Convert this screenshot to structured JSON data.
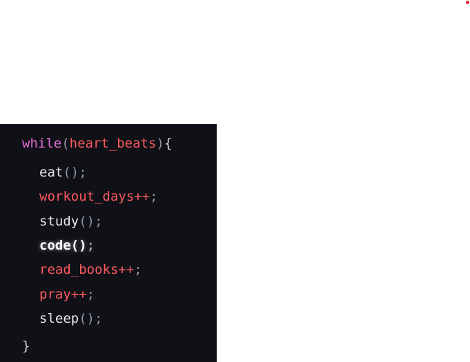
{
  "accent": {
    "dot_color": "#e8232a",
    "background": "#0f1117",
    "keyword_color": "#e26bd8",
    "identifier_red": "#ff5a5f"
  },
  "code": {
    "line0": {
      "keyword": "while",
      "open_paren": "(",
      "condition": "heart_beats",
      "close_paren": ")",
      "open_brace": "{"
    },
    "line1": {
      "fn": "eat",
      "call": "()",
      "semi": ";"
    },
    "line2": {
      "var": "workout_days++",
      "semi": ";"
    },
    "line3": {
      "fn": "study",
      "call": "()",
      "semi": ";"
    },
    "line4": {
      "fn": "code",
      "call": "()",
      "semi": ";"
    },
    "line5": {
      "var": "read_books++",
      "semi": ";"
    },
    "line6": {
      "var": "pray++",
      "semi": ";"
    },
    "line7": {
      "fn": "sleep",
      "call": "()",
      "semi": ";"
    },
    "line8": {
      "close_brace": "}"
    }
  }
}
